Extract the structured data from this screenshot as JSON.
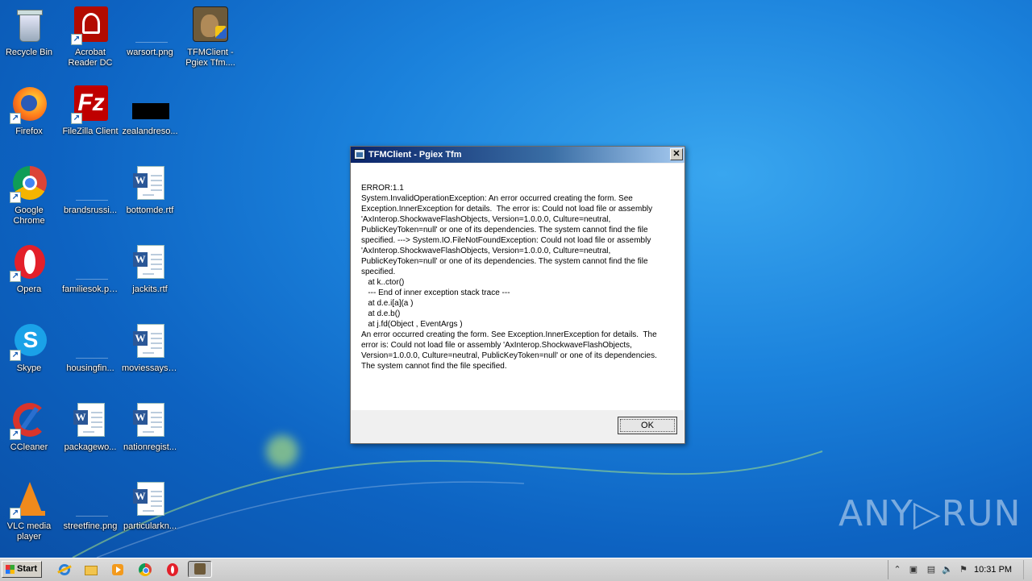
{
  "desktop": {
    "icons": [
      {
        "label": "Recycle Bin"
      },
      {
        "label": "Acrobat Reader DC"
      },
      {
        "label": "warsort.png"
      },
      {
        "label": "TFMClient - Pgiex Tfm...."
      },
      {
        "label": "Firefox"
      },
      {
        "label": "FileZilla Client"
      },
      {
        "label": "zealandreso..."
      },
      {
        "label": "Google Chrome"
      },
      {
        "label": "brandsrussi..."
      },
      {
        "label": "bottomde.rtf"
      },
      {
        "label": "Opera"
      },
      {
        "label": "familiesok.png"
      },
      {
        "label": "jackits.rtf"
      },
      {
        "label": "Skype"
      },
      {
        "label": "housingfin..."
      },
      {
        "label": "moviessays.rtf"
      },
      {
        "label": "CCleaner"
      },
      {
        "label": "packagewo..."
      },
      {
        "label": "nationregist..."
      },
      {
        "label": "VLC media player"
      },
      {
        "label": "streetfine.png"
      },
      {
        "label": "particularkn..."
      }
    ]
  },
  "dialog": {
    "title": "TFMClient - Pgiex Tfm",
    "close_label": "✕",
    "message": "ERROR:1.1\nSystem.InvalidOperationException: An error occurred creating the form. See Exception.InnerException for details.  The error is: Could not load file or assembly 'AxInterop.ShockwaveFlashObjects, Version=1.0.0.0, Culture=neutral, PublicKeyToken=null' or one of its dependencies. The system cannot find the file specified. ---> System.IO.FileNotFoundException: Could not load file or assembly 'AxInterop.ShockwaveFlashObjects, Version=1.0.0.0, Culture=neutral, PublicKeyToken=null' or one of its dependencies. The system cannot find the file specified.\n   at k..ctor()\n   --- End of inner exception stack trace ---\n   at d.e.i[a](a )\n   at d.e.b()\n   at j.fd(Object , EventArgs )\nAn error occurred creating the form. See Exception.InnerException for details.  The error is: Could not load file or assembly 'AxInterop.ShockwaveFlashObjects, Version=1.0.0.0, Culture=neutral, PublicKeyToken=null' or one of its dependencies. The system cannot find the file specified.",
    "ok_label": "OK"
  },
  "watermark": "ANY▷RUN",
  "taskbar": {
    "start_label": "Start",
    "clock": "10:31 PM",
    "tray_expand": "⌃"
  },
  "colors": {
    "desktop_bg": "#1b82dc",
    "titlebar": "#0a246a",
    "taskbar": "#d4d0c8"
  }
}
